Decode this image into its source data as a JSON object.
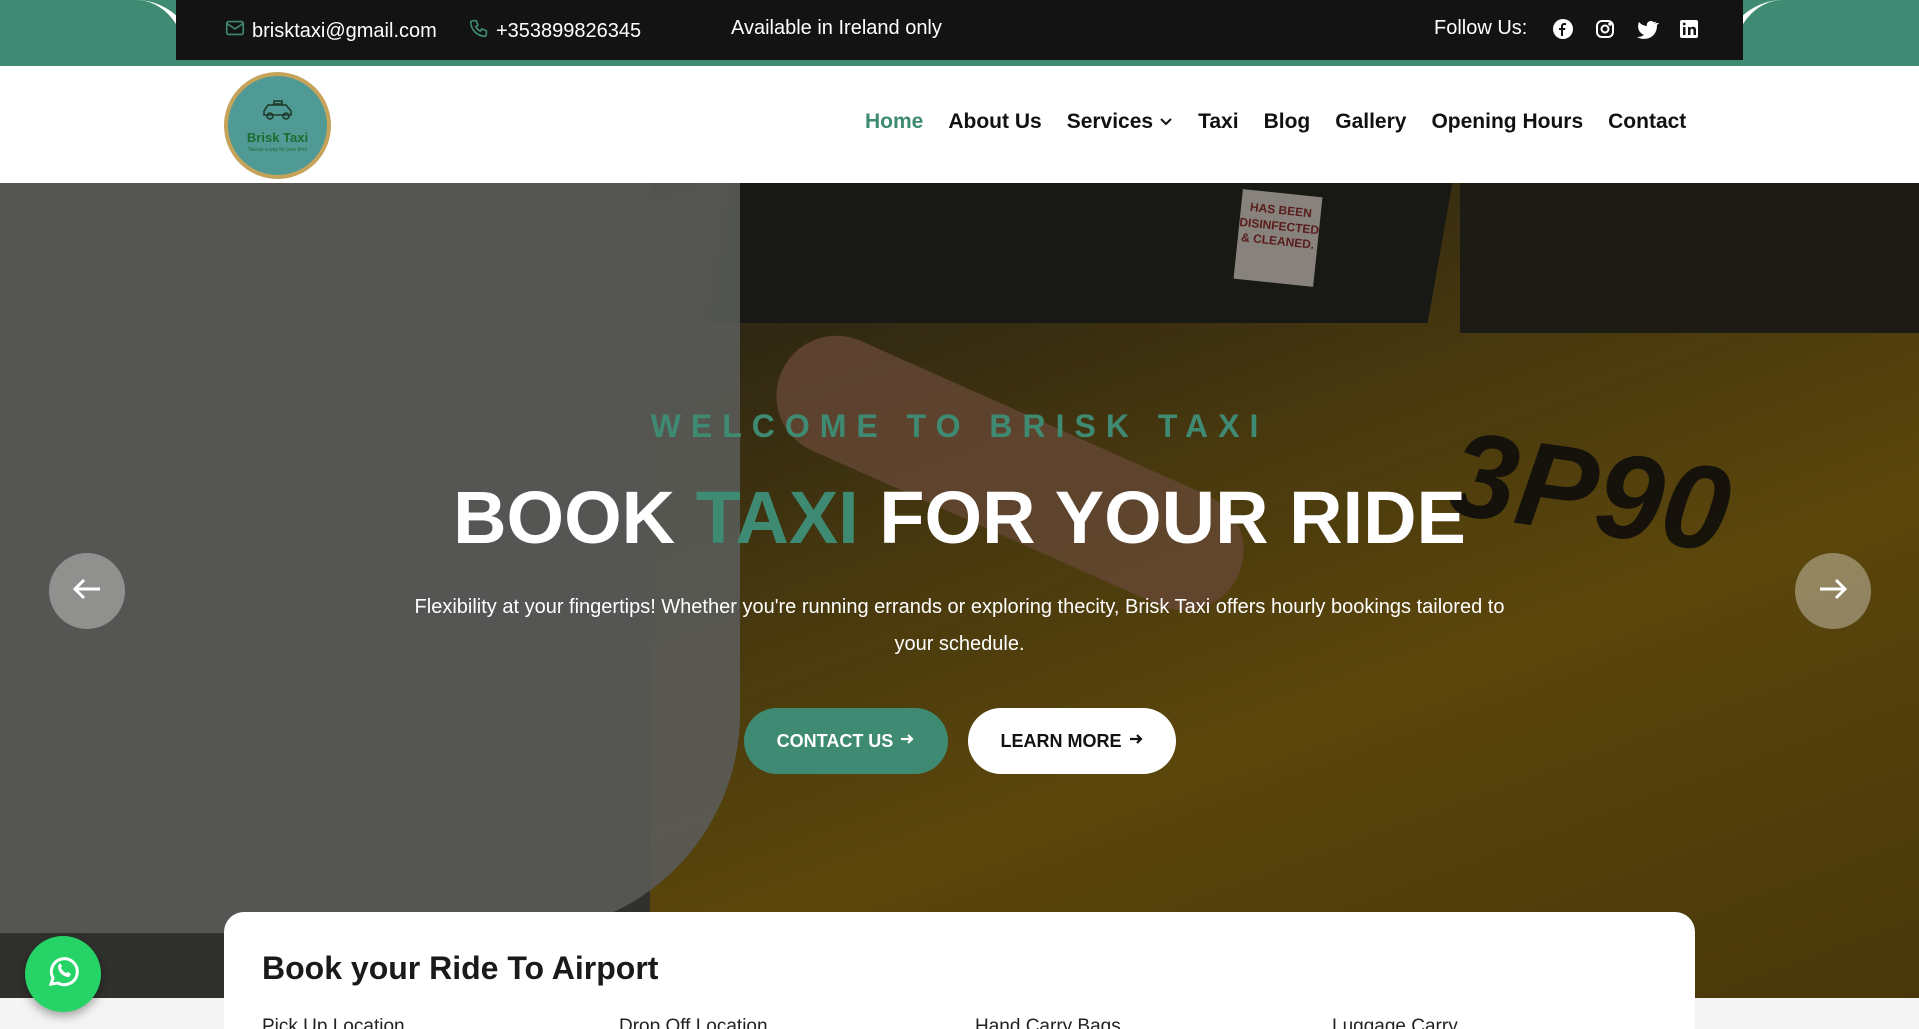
{
  "topbar": {
    "email": "brisktaxi@gmail.com",
    "phone": "+353899826345",
    "availability": "Available in Ireland only",
    "follow_label": "Follow Us:",
    "social": [
      "facebook-icon",
      "instagram-icon",
      "twitter-icon",
      "linkedin-icon"
    ]
  },
  "header": {
    "logo_text": "Brisk Taxi",
    "logo_subtext": "Taxi as a way for your time",
    "nav": [
      {
        "label": "Home",
        "active": true
      },
      {
        "label": "About Us"
      },
      {
        "label": "Services",
        "has_dropdown": true
      },
      {
        "label": "Taxi"
      },
      {
        "label": "Blog"
      },
      {
        "label": "Gallery"
      },
      {
        "label": "Opening Hours"
      },
      {
        "label": "Contact"
      }
    ]
  },
  "hero": {
    "kicker": "WELCOME TO BRISK TAXI",
    "title_part1": "BOOK ",
    "title_accent": "TAXI",
    "title_part2": " FOR YOUR RIDE",
    "subtitle": "Flexibility at your fingertips! Whether you're running errands or exploring thecity, Brisk Taxi offers hourly bookings tailored to your schedule.",
    "contact_button": "CONTACT US",
    "learn_button": "LEARN MORE",
    "sticker_text": "HAS BEEN DISINFECTED & CLEANED.",
    "plate_text": "3P90"
  },
  "booking": {
    "title": "Book your Ride To Airport",
    "labels": [
      "Pick Up Location",
      "Drop Off Location",
      "Hand Carry Bags",
      "Luggage Carry"
    ]
  },
  "colors": {
    "accent": "#3f8a72",
    "topbar_dark": "#131313",
    "whatsapp": "#25d366"
  }
}
